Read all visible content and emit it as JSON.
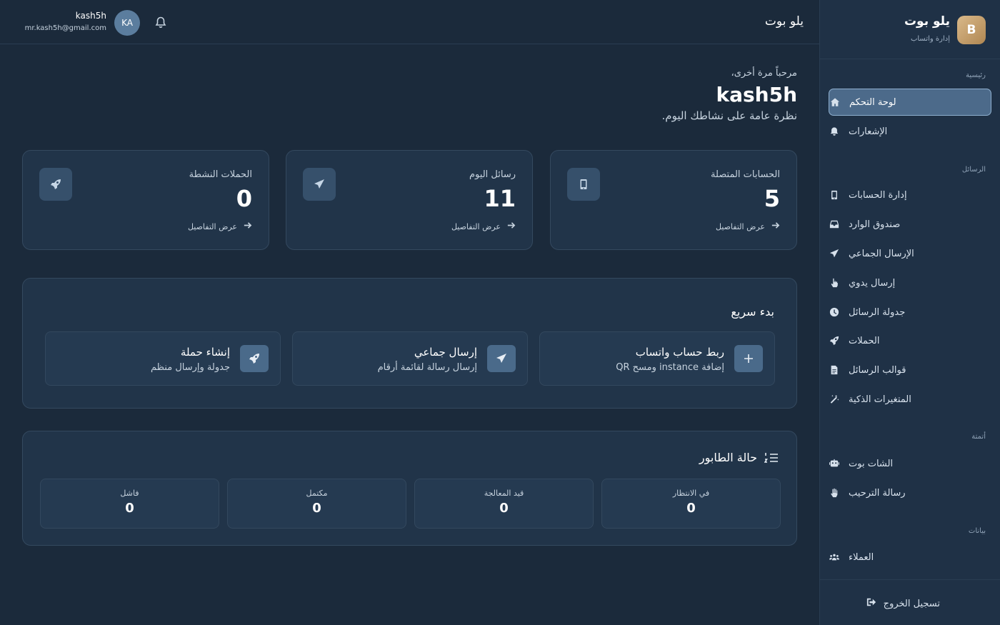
{
  "sidebar": {
    "logo_letter": "B",
    "title": "يلو بوت",
    "subtitle": "إدارة واتساب",
    "sections": [
      {
        "label": "رئيسية"
      },
      {
        "label": "الرسائل"
      },
      {
        "label": "أتمتة"
      },
      {
        "label": "بيانات"
      }
    ],
    "items": [
      {
        "label": "لوحة التحكم",
        "icon": "home-icon",
        "active": true
      },
      {
        "label": "الإشعارات",
        "icon": "bell-icon"
      },
      {
        "label": "إدارة الحسابات",
        "icon": "mobile-icon"
      },
      {
        "label": "صندوق الوارد",
        "icon": "inbox-icon"
      },
      {
        "label": "الإرسال الجماعي",
        "icon": "paper-plane-icon"
      },
      {
        "label": "إرسال يدوي",
        "icon": "hand-pointer-icon"
      },
      {
        "label": "جدولة الرسائل",
        "icon": "clock-icon"
      },
      {
        "label": "الحملات",
        "icon": "rocket-icon"
      },
      {
        "label": "قوالب الرسائل",
        "icon": "file-icon"
      },
      {
        "label": "المتغيرات الذكية",
        "icon": "magic-wand-icon"
      },
      {
        "label": "الشات بوت",
        "icon": "robot-icon"
      },
      {
        "label": "رسالة الترحيب",
        "icon": "wave-hand-icon"
      },
      {
        "label": "العملاء",
        "icon": "users-icon"
      }
    ],
    "logout_label": "تسجيل الخروج"
  },
  "topbar": {
    "title": "يلو بوت",
    "user_name": "kash5h",
    "user_email": "mr.kash5h@gmail.com",
    "avatar_initials": "KA"
  },
  "welcome": {
    "greeting": "مرحباً مرة أخرى،",
    "username": "kash5h",
    "subtitle": "نظرة عامة على نشاطك اليوم."
  },
  "stats": [
    {
      "label": "الحسابات المتصلة",
      "value": "5",
      "link": "عرض التفاصيل",
      "icon": "mobile-icon"
    },
    {
      "label": "رسائل اليوم",
      "value": "11",
      "link": "عرض التفاصيل",
      "icon": "paper-plane-icon"
    },
    {
      "label": "الحملات النشطة",
      "value": "0",
      "link": "عرض التفاصيل",
      "icon": "rocket-icon"
    }
  ],
  "quick_start": {
    "title": "بدء سريع",
    "actions": [
      {
        "title": "ربط حساب واتساب",
        "subtitle": "إضافة instance ومسح QR",
        "icon": "plus-icon"
      },
      {
        "title": "إرسال جماعي",
        "subtitle": "إرسال رسالة لقائمة أرقام",
        "icon": "paper-plane-icon"
      },
      {
        "title": "إنشاء حملة",
        "subtitle": "جدولة وإرسال منظم",
        "icon": "rocket-icon"
      }
    ]
  },
  "queue": {
    "title": "حالة الطابور",
    "items": [
      {
        "label": "في الانتظار",
        "value": "0"
      },
      {
        "label": "قيد المعالجة",
        "value": "0"
      },
      {
        "label": "مكتمل",
        "value": "0"
      },
      {
        "label": "فاشل",
        "value": "0"
      }
    ]
  }
}
